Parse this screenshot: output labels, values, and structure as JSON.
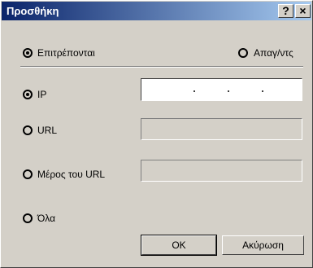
{
  "window": {
    "title": "Προσθήκη",
    "help_label": "?",
    "close_label": "×"
  },
  "mode": {
    "allow_label": "Επιτρέπονται",
    "deny_label": "Απαγ/ντς",
    "selected": "allow"
  },
  "target": {
    "ip_label": "IP",
    "url_label": "URL",
    "url_part_label": "Μέρος του URL",
    "all_label": "Όλα",
    "selected": "ip"
  },
  "fields": {
    "ip_value": "",
    "url_value": "",
    "url_part_value": ""
  },
  "buttons": {
    "ok_label": "OK",
    "cancel_label": "Ακύρωση"
  }
}
